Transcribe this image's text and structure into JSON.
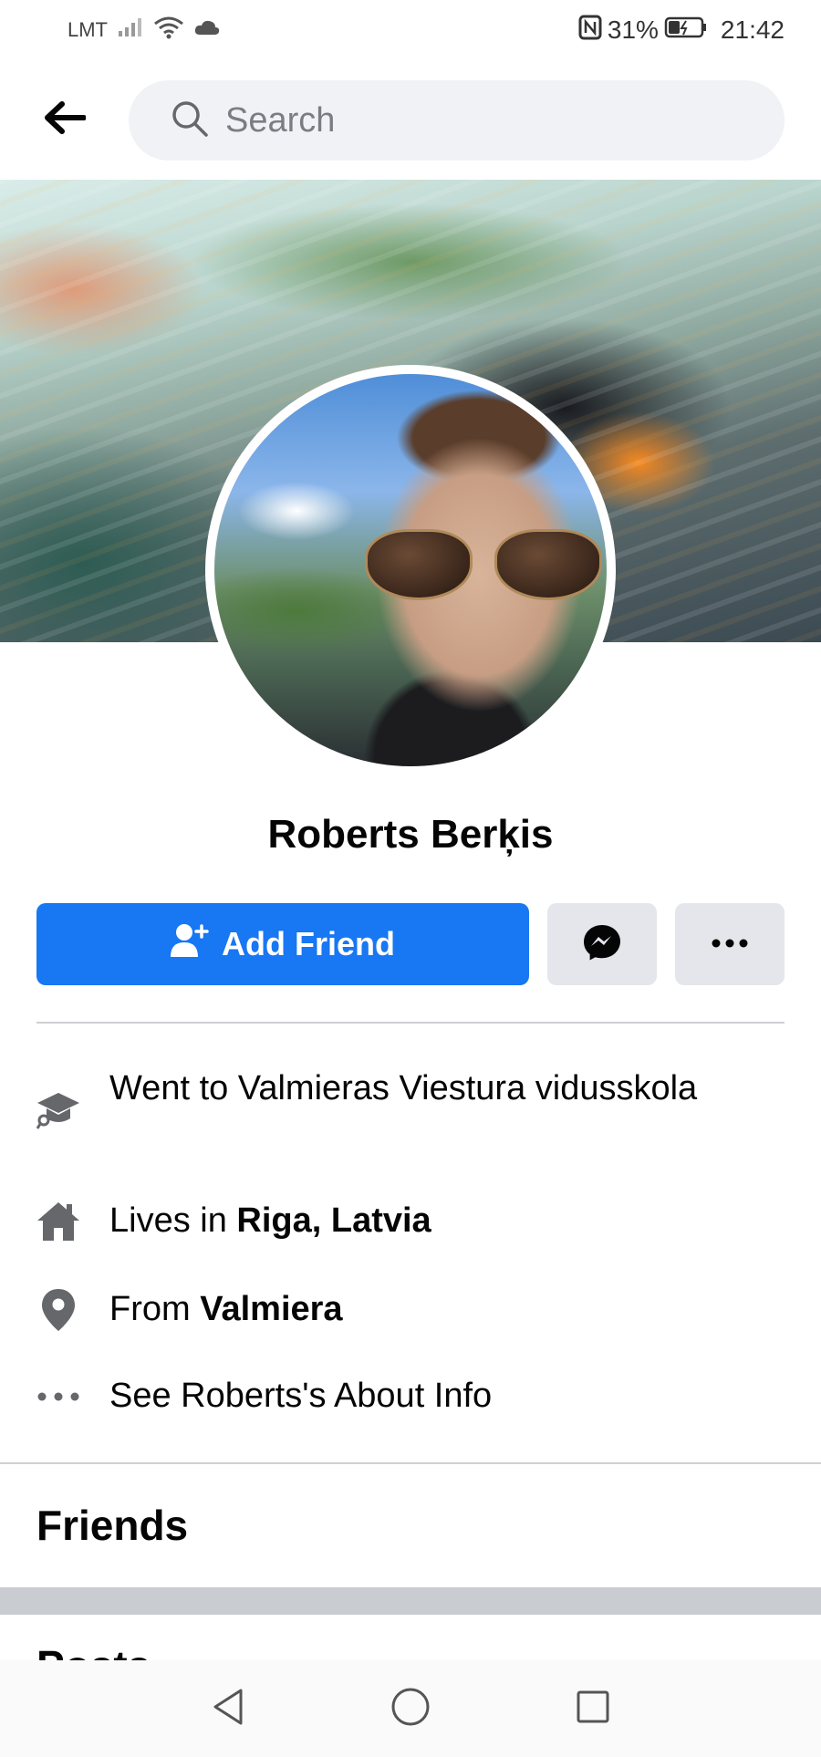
{
  "status_bar": {
    "carrier": "LMT",
    "battery_percent": "31%",
    "time": "21:42",
    "icons": [
      "signal-icon",
      "wifi-icon",
      "cloud-icon",
      "nfc-icon",
      "battery-icon"
    ]
  },
  "header": {
    "back_icon": "back-arrow-icon",
    "search_placeholder": "Search"
  },
  "profile": {
    "name": "Roberts Berķis",
    "add_friend_label": "Add Friend"
  },
  "intro": {
    "education": "Went to Valmieras Viestura vidusskola",
    "lives_prefix": "Lives in ",
    "lives_place": "Riga, Latvia",
    "from_prefix": "From ",
    "from_place": "Valmiera",
    "about_link": "See Roberts's About Info"
  },
  "sections": {
    "friends": "Friends",
    "posts": "Posts"
  },
  "colors": {
    "primary": "#1877f2",
    "secondary_button": "#e4e6eb",
    "search_bg": "#f0f2f5",
    "divider": "#ced0d4"
  }
}
